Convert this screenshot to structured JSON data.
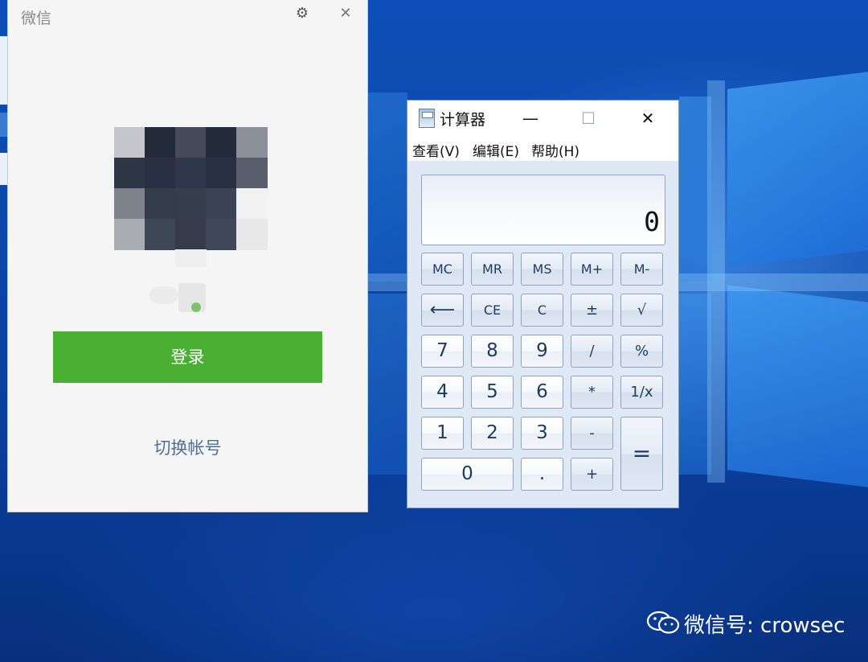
{
  "wechat": {
    "title": "微信",
    "settings_icon": "gear-icon",
    "close_icon": "close-icon",
    "login_button": "登录",
    "switch_account": "切换帐号",
    "accent": "#4ab034"
  },
  "calculator": {
    "title": "计算器",
    "minimize": "—",
    "maximize": "☐",
    "close": "✕",
    "menu": [
      "查看(V)",
      "编辑(E)",
      "帮助(H)"
    ],
    "display": "0",
    "keys": {
      "mc": "MC",
      "mr": "MR",
      "ms": "MS",
      "mplus": "M+",
      "mminus": "M-",
      "backspace": "⟵",
      "ce": "CE",
      "c": "C",
      "plusminus": "±",
      "sqrt": "√",
      "n7": "7",
      "n8": "8",
      "n9": "9",
      "divide": "/",
      "percent": "%",
      "n4": "4",
      "n5": "5",
      "n6": "6",
      "multiply": "*",
      "reciprocal": "1/x",
      "n1": "1",
      "n2": "2",
      "n3": "3",
      "minus": "-",
      "equals": "=",
      "n0": "0",
      "dot": ".",
      "plus": "+"
    }
  },
  "watermark": {
    "icon": "wechat-logo-icon",
    "text": "微信号: crowsec"
  }
}
